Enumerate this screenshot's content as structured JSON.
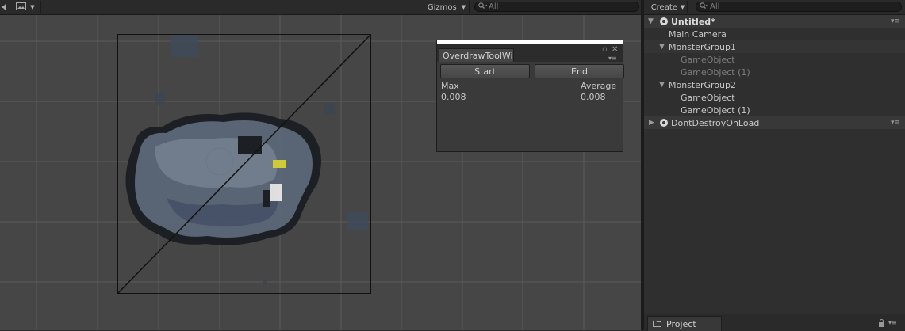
{
  "scene_toolbar": {
    "gizmos_label": "Gizmos",
    "search_placeholder": "All"
  },
  "overdraw_window": {
    "tab_title": "OverdrawToolWindow",
    "start_label": "Start",
    "end_label": "End",
    "max_label": "Max",
    "average_label": "Average",
    "max_value": "0.008",
    "average_value": "0.008"
  },
  "hierarchy": {
    "create_label": "Create",
    "search_placeholder": "All",
    "scene_name": "Untitled*",
    "items": [
      {
        "label": "Main Camera"
      },
      {
        "label": "MonsterGroup1"
      },
      {
        "label": "GameObject"
      },
      {
        "label": "GameObject (1)"
      },
      {
        "label": "MonsterGroup2"
      },
      {
        "label": "GameObject"
      },
      {
        "label": "GameObject (1)"
      }
    ],
    "dont_destroy_label": "DontDestroyOnLoad"
  },
  "project": {
    "tab_label": "Project"
  }
}
